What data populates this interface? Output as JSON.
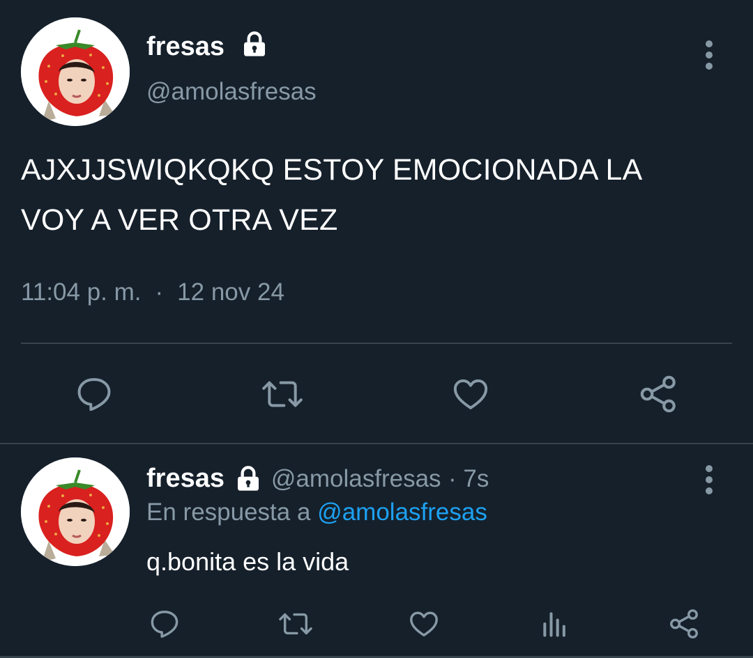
{
  "colors": {
    "background": "#15202b",
    "text_primary": "#ffffff",
    "text_secondary": "#8899a6",
    "divider": "#38444d",
    "link": "#1da1f2"
  },
  "main_tweet": {
    "display_name": "fresas",
    "handle": "@amolasfresas",
    "locked_icon": "lock-icon",
    "avatar_icon": "strawberry-avatar",
    "text_line1": "AJXJJSWIQKQKQ ESTOY EMOCIONADA LA",
    "text_line2": "VOY A VER OTRA VEZ",
    "time": "11:04 p. m.",
    "separator": "·",
    "date": "12 nov 24",
    "more_icon": "more-vertical-icon",
    "actions": [
      "reply-icon",
      "retweet-icon",
      "like-icon",
      "share-icon"
    ]
  },
  "reply_tweet": {
    "display_name": "fresas",
    "handle": "@amolasfresas",
    "age": "· 7s",
    "reply_prefix": "En respuesta a",
    "reply_mention": "@amolasfresas",
    "text": "q.bonita es la vida",
    "more_icon": "more-vertical-icon",
    "actions": [
      "reply-icon",
      "retweet-icon",
      "like-icon",
      "analytics-icon",
      "share-icon"
    ]
  }
}
